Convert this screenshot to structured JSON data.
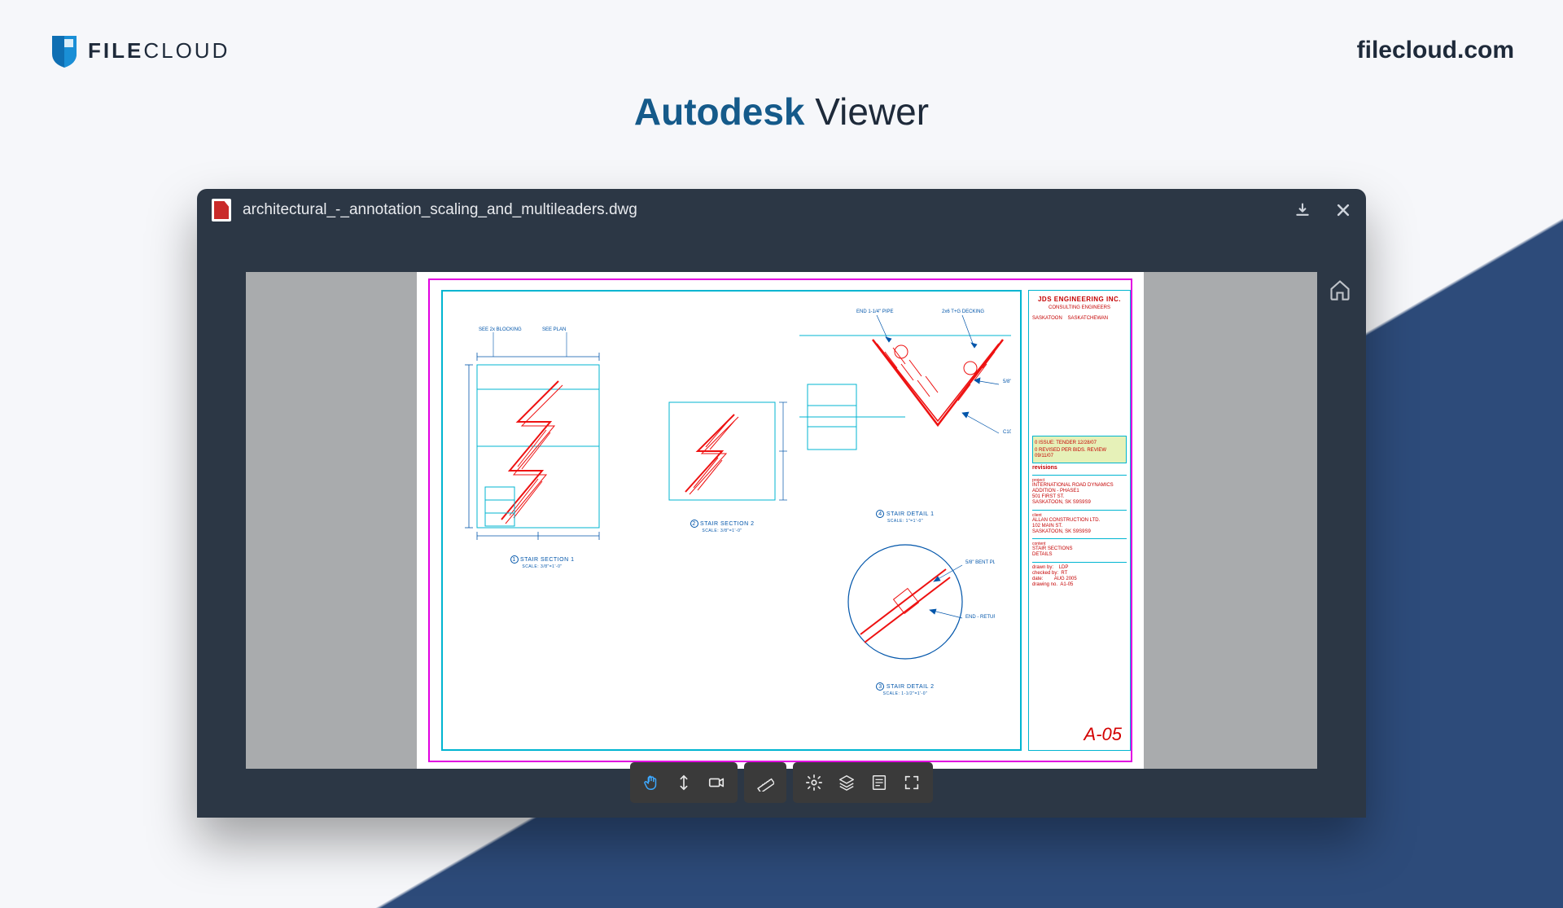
{
  "brand": {
    "name_bold": "FILE",
    "name_light": "CLOUD"
  },
  "site_url": "filecloud.com",
  "page_title": {
    "strong": "Autodesk",
    "rest": " Viewer"
  },
  "viewer": {
    "filename": "architectural_-_annotation_scaling_and_multileaders.dwg",
    "download_icon": "download-icon",
    "close_icon": "close-icon",
    "home_icon": "home-icon"
  },
  "titleblock": {
    "company": "JDS ENGINEERING INC.",
    "company_sub": "CONSULTING ENGINEERS",
    "city_left": "SASKATOON",
    "city_right": "SASKATCHEWAN",
    "revisions_label": "revisions",
    "rev1": "0  ISSUE: TENDER        12/28/07",
    "rev2": "0  REVISED PER BIDS. REVIEW  09/11/07",
    "project_head": "project",
    "project_lines": [
      "INTERNATIONAL ROAD DYNAMICS",
      "ADDITION - PHASE1",
      "501 FIRST ST.",
      "SASKATOON, SK  S9S9S9"
    ],
    "client_head": "client",
    "client_lines": [
      "ALLAN CONSTRUCTION LTD.",
      "102 MAIN ST.",
      "SASKATOON, SK  S9S9S9"
    ],
    "content_head": "content",
    "content_lines": [
      "STAIR SECTIONS",
      "DETAILS"
    ],
    "meta": {
      "drawn_by_label": "drawn by:",
      "drawn_by": "LDP",
      "checked_by_label": "checked by:",
      "checked_by": "RT",
      "date_label": "date:",
      "date": "AUG 2005",
      "drawing_no_label": "drawing no.",
      "drawing_no": "A1-05"
    },
    "sheet_no": "A-05"
  },
  "details": {
    "d1_label": "STAIR SECTION 1",
    "d1_scale": "SCALE: 3/8\"=1'-0\"",
    "d1_num": "1",
    "d2_label": "STAIR SECTION 2",
    "d2_scale": "SCALE: 3/8\"=1'-0\"",
    "d2_num": "2",
    "d3_label": "STAIR DETAIL 1",
    "d3_scale": "SCALE: 1\"=1'-0\"",
    "d3_num": "4",
    "d4_label": "STAIR DETAIL 2",
    "d4_scale": "SCALE: 1-1/2\"=1'-0\"",
    "d4_num": "3"
  },
  "toolbar": {
    "pan": "pan-tool",
    "orbit": "orbit-tool",
    "camera": "camera-tool",
    "measure": "measure-tool",
    "settings": "settings-tool",
    "layers": "layers-tool",
    "properties": "properties-tool",
    "fullscreen": "fullscreen-tool"
  }
}
